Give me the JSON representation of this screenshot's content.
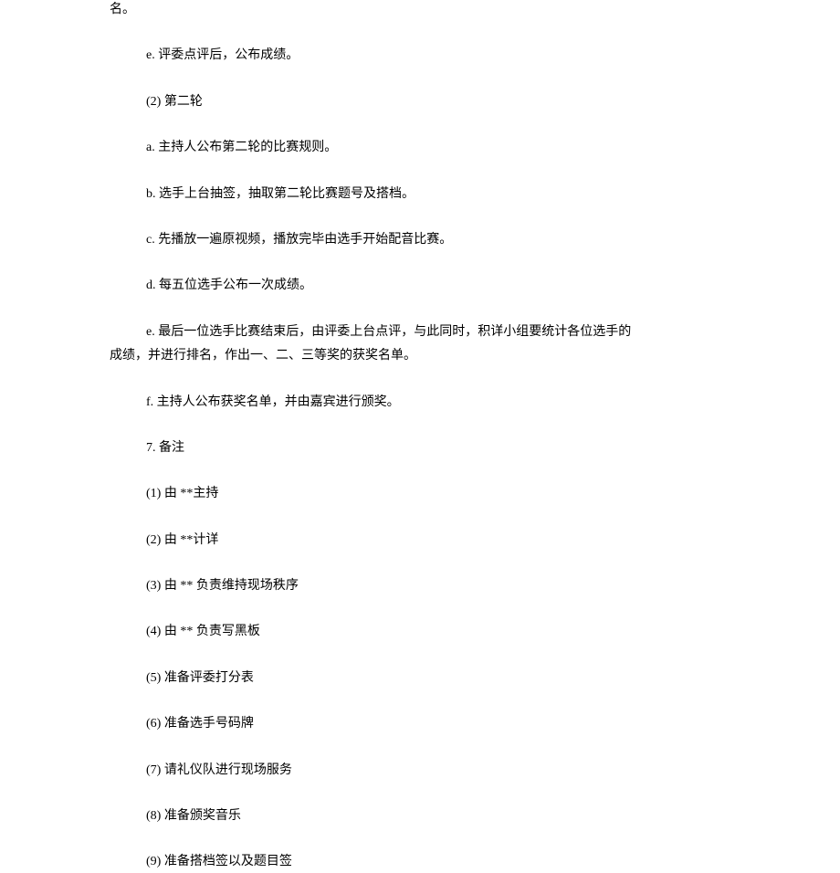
{
  "lines": {
    "l0": "名。",
    "l1": "e.  评委点评后，公布成绩。",
    "l2": "(2)  第二轮",
    "l3": "a.  主持人公布第二轮的比赛规则。",
    "l4": "b.  选手上台抽签，抽取第二轮比赛题号及搭档。",
    "l5": "c.  先播放一遍原视频，播放完毕由选手开始配音比赛。",
    "l6": "d.  每五位选手公布一次成绩。",
    "l7a": "e.  最后一位选手比赛结束后，由评委上台点评，与此同时，积详小组要统计各位选手的",
    "l7b": "成绩，并进行排名，作出一、二、三等奖的获奖名单。",
    "l8": "f.   主持人公布获奖名单，并由嘉宾进行颁奖。",
    "l9": "7.  备注",
    "l10": "(1) 由  **主持",
    "l11": "(2) 由  **计详",
    "l12": "(3)  由  ** 负责维持现场秩序",
    "l13": "(4) 由  ** 负责写黑板",
    "l14": "(5) 准备评委打分表",
    "l15": "(6) 准备选手号码牌",
    "l16": "(7) 请礼仪队进行现场服务",
    "l17": "(8) 准备颁奖音乐",
    "l18": "(9) 准备搭档签以及题目签"
  }
}
